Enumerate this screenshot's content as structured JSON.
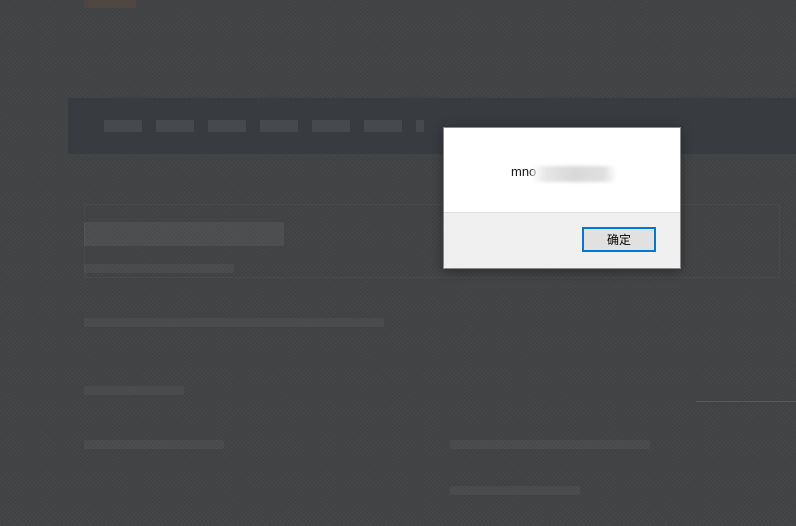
{
  "dialog": {
    "message": "mno",
    "ok_label": "确定"
  }
}
